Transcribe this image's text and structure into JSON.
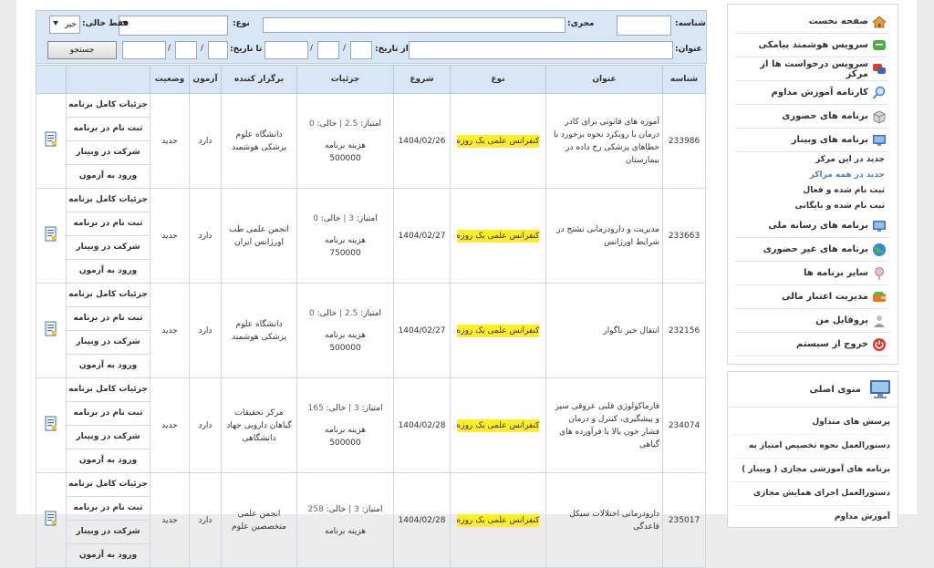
{
  "sidebar": {
    "items": [
      {
        "label": "صفحه نخست",
        "icon": "home-icon"
      },
      {
        "label": "سرویس هوشمند پیامکی",
        "icon": "sms-icon"
      },
      {
        "label": "سرویس درخواست ها از مرکز",
        "icon": "chat-icon"
      },
      {
        "label": "کارنامه آموزش مداوم",
        "icon": "magnifier-icon"
      },
      {
        "label": "برنامه های حضوری",
        "icon": "box-icon"
      },
      {
        "label": "برنامه های وبینار",
        "icon": "monitor-icon"
      }
    ],
    "subitems": [
      {
        "label": "جدید در این مرکز",
        "active": false
      },
      {
        "label": "جدید در همه مراکز",
        "active": true
      },
      {
        "label": "ثبت نام شده و فعال",
        "active": false
      },
      {
        "label": "ثبت نام شده و بایگانی",
        "active": false
      }
    ],
    "items2": [
      {
        "label": "برنامه های رسانه ملی",
        "icon": "monitor-icon"
      },
      {
        "label": "برنامه های غیر حضوری",
        "icon": "globe-icon"
      },
      {
        "label": "سایر برنامه ها",
        "icon": "pin-icon"
      },
      {
        "label": "مدیریت اعتبار مالی",
        "icon": "wallet-icon"
      },
      {
        "label": "پروفایل من",
        "icon": "user-icon"
      },
      {
        "label": "خروج از سیستم",
        "icon": "power-icon"
      }
    ]
  },
  "content_menu": {
    "title": "منوی اصلی",
    "items": [
      "پرسش های متداول",
      "دستورالعمل نحوه تخصیص امتیاز به",
      "برنامه های آموزشی مجازی ( وبینار )",
      "دستورالعمل اجرای همایش مجازی",
      "آموزش مداوم"
    ]
  },
  "search": {
    "id_label": "شناسه:",
    "executor_label": "مجری:",
    "type_label": "نوع:",
    "free_only_label": "فقط خالی:",
    "free_only_value": "خیر",
    "title_label": "عنوان:",
    "from_date_label": "از تاریخ:",
    "to_date_label": "تا تاریخ:",
    "search_button": "جستجو"
  },
  "table": {
    "headers": [
      "شناسه",
      "عنوان",
      "نوع",
      "شروع",
      "جزئیات",
      "برگزار کننده",
      "آزمون",
      "وضعیت"
    ],
    "actions": [
      "جزئیات کامل برنامه",
      "ثبت نام در برنامه",
      "شرکت در وبینار",
      "ورود به آزمون"
    ],
    "score_label": "امتیاز:",
    "free_label": "خالی:",
    "fee_label": "هزینه برنامه",
    "rows": [
      {
        "id": "233986",
        "title": "آموزه های قانونی برای کادر درمان با رویکرد نحوه برخورد با خطاهای پزشکی رخ داده در بیمارستان",
        "type": "کنفرانس علمی یک روزه",
        "start": "1404/02/26",
        "score": "2.5",
        "free": "0",
        "fee": "500000",
        "organizer": "دانشگاه علوم پزشکی هوشمند",
        "exam": "دارد",
        "status": "جدید"
      },
      {
        "id": "233663",
        "title": "مدیریت و دارودرمانی تشنج در شرایط اورژانس",
        "type": "کنفرانس علمی یک روزه",
        "start": "1404/02/27",
        "score": "3",
        "free": "0",
        "fee": "750000",
        "organizer": "انجمن علمی طب اورژانس ایران",
        "exam": "دارد",
        "status": "جدید"
      },
      {
        "id": "232156",
        "title": "انتقال خبر ناگوار",
        "type": "کنفرانس علمی یک روزه",
        "start": "1404/02/27",
        "score": "2.5",
        "free": "0",
        "fee": "500000",
        "organizer": "دانشگاه علوم پزشکی هوشمند",
        "exam": "دارد",
        "status": "جدید"
      },
      {
        "id": "234074",
        "title": "فارماکولوژی قلبی عروقی سیر و پیشگیری، کنترل و درمان فشار خون بالا با فرآورده های گیاهی",
        "type": "کنفرانس علمی یک روزه",
        "start": "1404/02/28",
        "score": "3",
        "free": "165",
        "fee": "500000",
        "organizer": "مرکز تحقیقات گیاهان دارویی جهاد دانشگاهی",
        "exam": "دارد",
        "status": "جدید"
      },
      {
        "id": "235017",
        "title": "دارودرمانی اختلالات سیکل قاعدگی",
        "type": "کنفرانس علمی یک روزه",
        "start": "1404/02/28",
        "score": "3",
        "free": "258",
        "fee": "",
        "organizer": "انجمن علمی متخصصین علوم",
        "exam": "دارد",
        "status": "جدید"
      }
    ]
  }
}
